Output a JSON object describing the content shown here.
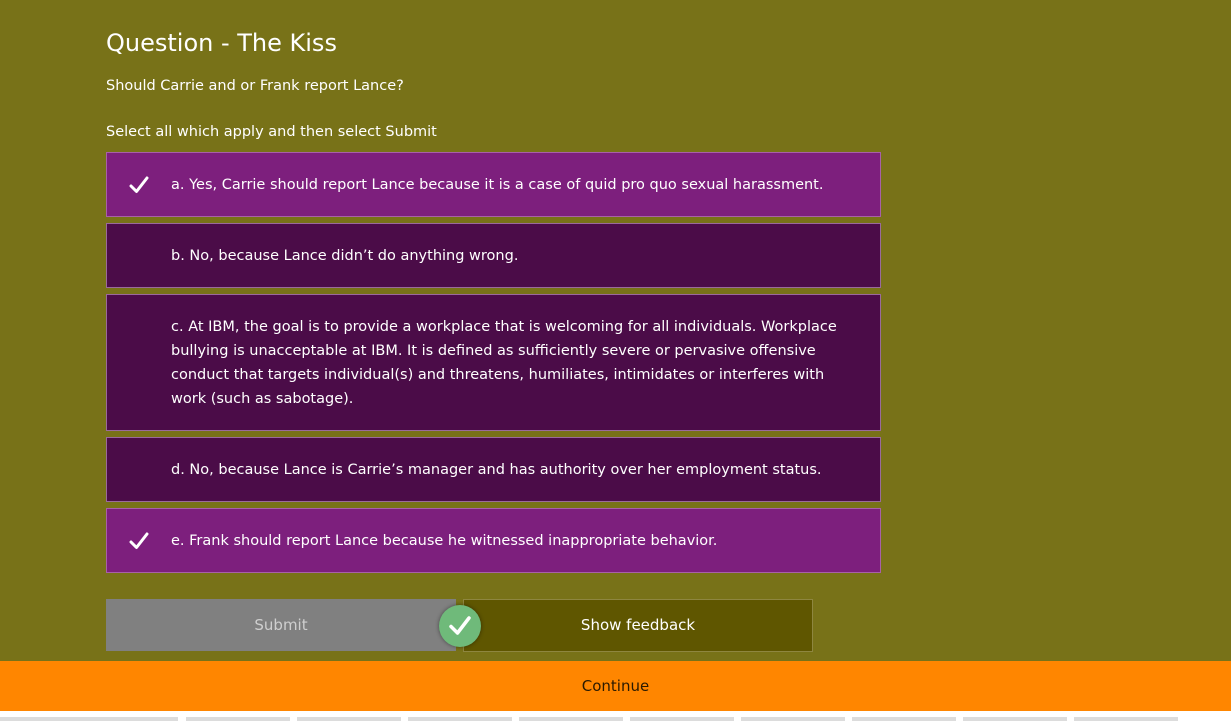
{
  "question": {
    "title": "Question - The Kiss",
    "prompt": "Should Carrie and or Frank report Lance?",
    "instruction": "Select all which apply and then select Submit"
  },
  "options": [
    {
      "text": "a. Yes, Carrie should report Lance because it is a case of quid pro quo sexual harassment.",
      "selected": true
    },
    {
      "text": "b. No, because Lance didn’t do anything wrong.",
      "selected": false
    },
    {
      "text": "c. At IBM, the goal is to provide a workplace that is welcoming for all individuals. Workplace bullying is unacceptable at IBM. It is defined as sufficiently severe or pervasive offensive conduct that targets individual(s) and threatens, humiliates, intimidates or interferes with work (such as sabotage).",
      "selected": false
    },
    {
      "text": "d. No, because Lance is Carrie’s manager and has authority over her employment status.",
      "selected": false
    },
    {
      "text": "e. Frank should report Lance because he witnessed inappropriate behavior.",
      "selected": true
    }
  ],
  "actions": {
    "submit_label": "Submit",
    "feedback_label": "Show feedback",
    "continue_label": "Continue"
  },
  "icons": {
    "option_check": "checkmark-icon",
    "result": "correct-checkmark-icon"
  },
  "colors": {
    "background": "#787218",
    "option_selected": "#7d1f7d",
    "option_unselected": "#4b0c48",
    "continue_bar": "#ff8600",
    "correct_badge": "#6fba7a"
  }
}
